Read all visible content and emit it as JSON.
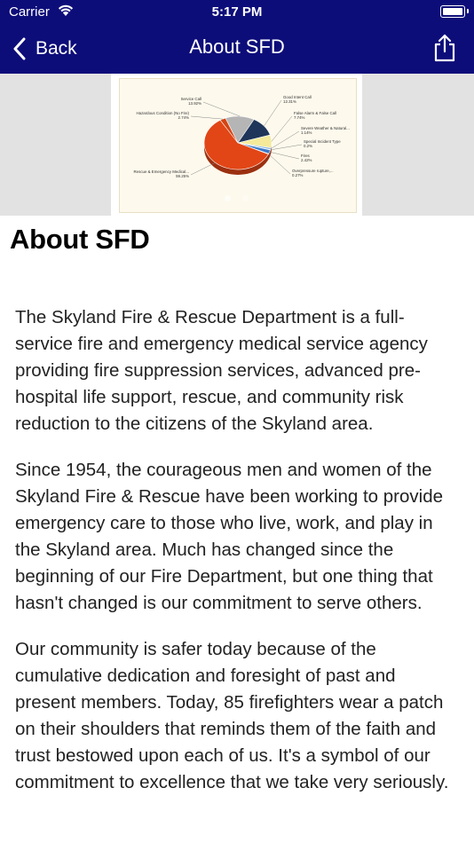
{
  "status_bar": {
    "carrier": "Carrier",
    "time": "5:17 PM"
  },
  "nav": {
    "back_label": "Back",
    "title": "About SFD"
  },
  "chart_data": {
    "type": "pie",
    "title": "",
    "slices": [
      {
        "label": "Service Call",
        "value": 13.92,
        "value_label": "13.92%",
        "color": "#b5b5b5"
      },
      {
        "label": "Good Intent Call",
        "value": 12.31,
        "value_label": "12.31%",
        "color": "#1f3559"
      },
      {
        "label": "False Alarm & False Call",
        "value": 7.74,
        "value_label": "7.74%",
        "color": "#f4ea9a"
      },
      {
        "label": "Severe Weather & Natural...",
        "value": 1.14,
        "value_label": "1.14%",
        "color": "#8ab8e4"
      },
      {
        "label": "Special Incident Type",
        "value": 0.2,
        "value_label": "0.2%",
        "color": "#6e6e6e"
      },
      {
        "label": "Fires",
        "value": 2.42,
        "value_label": "2.42%",
        "color": "#3b79c8"
      },
      {
        "label": "Overpressure rupture,...",
        "value": 0.27,
        "value_label": "0.27%",
        "color": "#9bbf56"
      },
      {
        "label": "Rescue & Emergency Medical...",
        "value": 59.25,
        "value_label": "59.25%",
        "color": "#e24616"
      },
      {
        "label": "Hazardous Condition (No Fire)",
        "value": 2.74,
        "value_label": "2.74%",
        "color": "#d44414"
      }
    ],
    "legend": "labels around pie"
  },
  "page": {
    "heading": "About SFD",
    "paragraphs": [
      "The Skyland Fire & Rescue Department is a full-service fire and emergency medical service agency providing fire suppression services, advanced pre-hospital life support, rescue, and community risk reduction to the citizens of the Skyland area.",
      "Since 1954, the courageous men and women of the Skyland Fire & Rescue have been working to provide emergency care to those who live, work, and play in the Skyland area. Much has changed since the beginning of our Fire Department, but one thing that hasn't changed is our commitment to serve others.",
      "Our community is safer today because of the cumulative dedication and foresight of past and present members. Today, 85 firefighters wear a patch on their shoulders that reminds them of the faith and trust bestowed upon each of us. It's a symbol of our commitment to excellence that we take very seriously."
    ]
  }
}
